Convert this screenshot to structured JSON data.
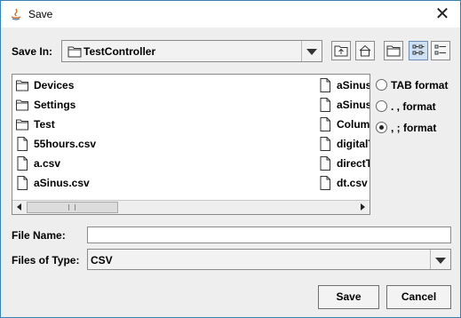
{
  "window": {
    "title": "Save",
    "close_icon": "close-icon",
    "app_icon": "java-icon"
  },
  "save_in": {
    "label": "Save In:",
    "value": "TestController",
    "folder_icon": "folder-icon"
  },
  "toolbar": {
    "buttons": [
      {
        "name": "up-one-level-icon",
        "selected": false
      },
      {
        "name": "home-icon",
        "selected": false
      },
      {
        "name": "new-folder-icon",
        "selected": false
      },
      {
        "name": "list-view-icon",
        "selected": true
      },
      {
        "name": "details-view-icon",
        "selected": false
      }
    ]
  },
  "files": {
    "column1": [
      {
        "type": "folder",
        "name": "Devices"
      },
      {
        "type": "folder",
        "name": "Settings"
      },
      {
        "type": "folder",
        "name": "Test"
      },
      {
        "type": "file",
        "name": "55hours.csv"
      },
      {
        "type": "file",
        "name": "a.csv"
      },
      {
        "type": "file",
        "name": "aSinus.csv"
      }
    ],
    "column2": [
      {
        "type": "file",
        "name": "aSinus"
      },
      {
        "type": "file",
        "name": "aSinus"
      },
      {
        "type": "file",
        "name": "Column"
      },
      {
        "type": "file",
        "name": "digitalT"
      },
      {
        "type": "file",
        "name": "directT"
      },
      {
        "type": "file",
        "name": "dt.csv"
      }
    ]
  },
  "formats": [
    {
      "label": "TAB format",
      "checked": false
    },
    {
      "label": ". , format",
      "checked": false
    },
    {
      "label": ", ; format",
      "checked": true
    }
  ],
  "file_name": {
    "label": "File Name:",
    "value": ""
  },
  "file_type": {
    "label": "Files of Type:",
    "value": "CSV"
  },
  "buttons": {
    "save": "Save",
    "cancel": "Cancel"
  }
}
